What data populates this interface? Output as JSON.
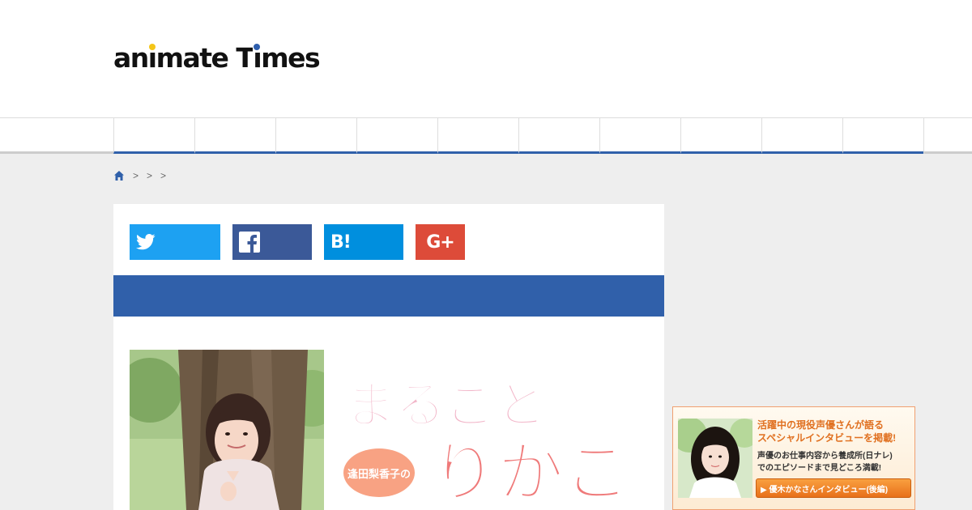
{
  "header": {
    "logo": {
      "part1": "an",
      "i1": "i",
      "part2": "mate ",
      "part3": "T",
      "i2": "i",
      "part4": "mes"
    },
    "colors": {
      "accent_blue": "#3060aa",
      "logo_dot_yellow": "#f4c518",
      "logo_dot_blue": "#2f5fad"
    }
  },
  "nav": {
    "item_count": 10
  },
  "breadcrumb": {
    "home_icon": "home-icon",
    "separators": [
      ">",
      ">",
      ">"
    ]
  },
  "share": {
    "twitter": {
      "icon": "twitter-icon",
      "color": "#1da1f2"
    },
    "facebook": {
      "label": "f",
      "icon": "facebook-icon",
      "color": "#3b5998"
    },
    "hatena": {
      "label": "B!",
      "icon": "hatena-bookmark-icon",
      "color": "#008fde"
    },
    "google": {
      "label": "G+",
      "icon": "google-plus-icon",
      "color": "#dd4b39"
    }
  },
  "article": {
    "title_art": {
      "main": "まるごと",
      "sub": "りかこ",
      "badge": "逢田梨香子の"
    }
  },
  "banner": {
    "headline": "活躍中の現役声優さんが語る\nスペシャルインタビューを掲載!",
    "sub": "声優のお仕事内容から養成所(日ナレ)\nでのエピソードまで見どころ満載!",
    "cta": "▶ 優木かなさんインタビュー(後編)"
  }
}
